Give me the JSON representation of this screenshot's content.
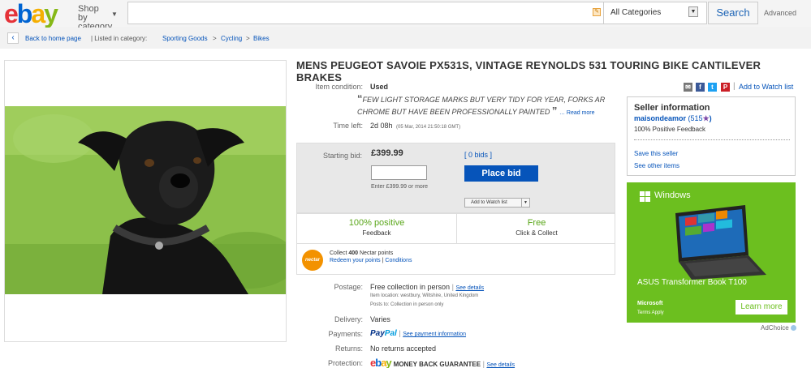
{
  "header": {
    "logo_text": "ebay",
    "shop_by_category": "Shop by category",
    "search_placeholder": "",
    "category_selected": "All Categories",
    "search_button": "Search",
    "advanced_link": "Advanced"
  },
  "breadcrumb": {
    "back": "Back to home page",
    "listed_in": "| Listed in category:",
    "items": [
      "Sporting Goods",
      "Cycling",
      "Bikes"
    ],
    "separator": ">"
  },
  "listing": {
    "title": "MENS PEUGEOT SAVOIE PX531S, VINTAGE REYNOLDS 531 TOURING BIKE CANTILEVER BRAKES",
    "condition_label": "Item condition:",
    "condition_value": "Used",
    "condition_description": "FEW LIGHT STORAGE MARKS BUT VERY TIDY FOR YEAR, FORKS AR CHROME BUT HAVE BEEN PROFESSIONALLY PAINTED",
    "read_more": "Read more",
    "time_left_label": "Time left:",
    "time_left_value": "2d 08h",
    "time_left_date": "(05 Mar, 2014   21:50:18 GMT)",
    "starting_bid_label": "Starting bid:",
    "starting_bid_value": "£399.99",
    "bids_link": "[ 0 bids ]",
    "bid_input_value": "",
    "bid_hint": "Enter £399.99 or more",
    "place_bid_button": "Place bid",
    "add_to_watch_list_button": "Add to Watch list",
    "positive_feedback": "100% positive",
    "feedback_label": "Feedback",
    "postage_free": "Free",
    "click_collect": "Click & Collect",
    "nectar_collect_prefix": "Collect",
    "nectar_points": "400",
    "nectar_collect_suffix": "Nectar points",
    "nectar_redeem": "Redeem your points",
    "nectar_conditions": "Conditions",
    "nectar_logo": "nectar",
    "postage_label": "Postage:",
    "postage_value": "Free collection in person",
    "see_details": "See details",
    "item_location": "Item location:  westbury, Wiltshire, United Kingdom",
    "posts_to": "Posts to:  Collection in person only",
    "delivery_label": "Delivery:",
    "delivery_value": "Varies",
    "payments_label": "Payments:",
    "paypal": [
      "Pay",
      "Pal"
    ],
    "see_payment_info": "See payment information",
    "returns_label": "Returns:",
    "returns_value": "No returns accepted",
    "protection_label": "Protection:",
    "mbg_text": "MONEY BACK GUARANTEE",
    "protection_see_details": "See details"
  },
  "sidebar": {
    "add_to_watch_list": "Add to Watch list",
    "seller_heading": "Seller information",
    "seller_name": "maisondeamor",
    "seller_score": "(515",
    "seller_score_close": ")",
    "seller_feedback": "100% Positive Feedback",
    "save_seller": "Save this seller",
    "other_items": "See other items"
  },
  "ad": {
    "windows": "Windows",
    "product": "ASUS Transformer Book T100",
    "microsoft": "Microsoft",
    "terms": "Terms Apply",
    "learn_more": "Learn more",
    "adchoice": "AdChoice"
  },
  "colors": {
    "ebay_e": "#e53238",
    "ebay_b": "#0064d2",
    "ebay_a": "#f5af02",
    "ebay_y": "#86b817",
    "link": "#0654ba",
    "ad_green": "#6cbf1f",
    "feedback_green": "#5ba71b"
  },
  "icons": [
    "back-arrow-icon",
    "search-clear-icon",
    "chevron-down-icon",
    "email-icon",
    "facebook-icon",
    "twitter-icon",
    "pinterest-icon",
    "star-icon",
    "windows-icon"
  ]
}
